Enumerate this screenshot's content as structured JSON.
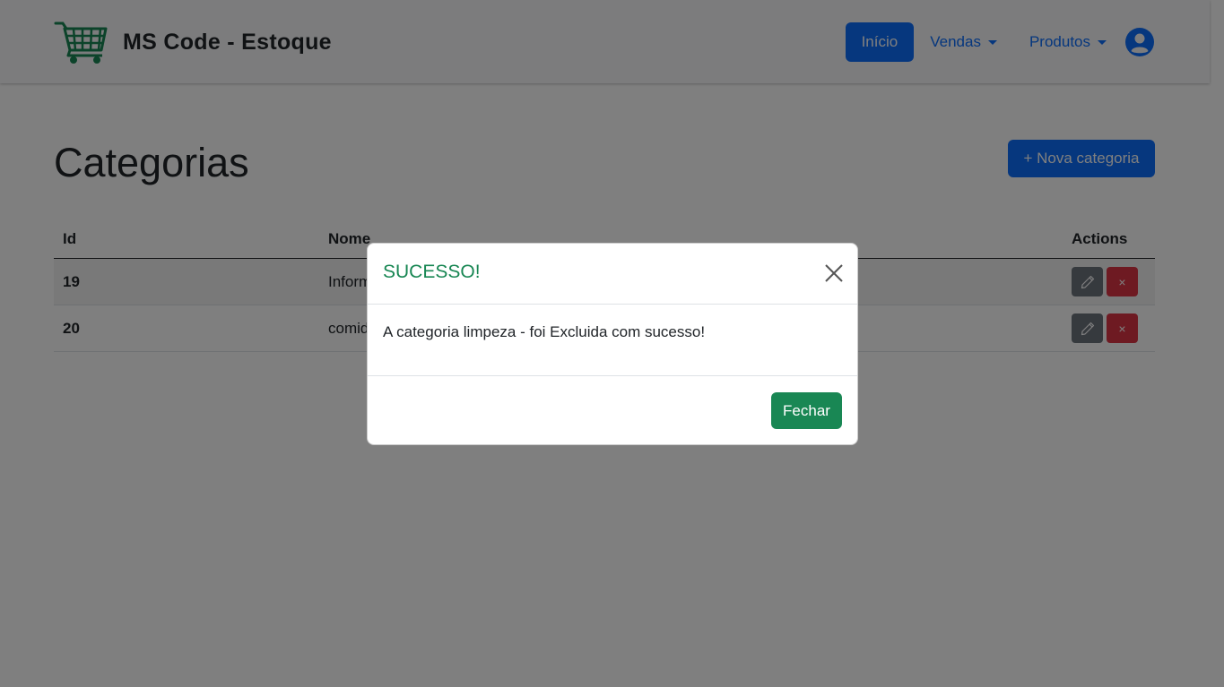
{
  "brand": {
    "title": "MS Code - Estoque",
    "logo_icon": "shopping-cart-icon",
    "logo_color": "#198754"
  },
  "nav": {
    "items": [
      {
        "label": "Início",
        "active": true
      },
      {
        "label": "Vendas",
        "dropdown": true
      },
      {
        "label": "Produtos",
        "dropdown": true
      }
    ],
    "user_icon": "user-circle-icon"
  },
  "page": {
    "title": "Categorias",
    "new_button": "+ Nova categoria"
  },
  "table": {
    "headers": {
      "id": "Id",
      "nome": "Nome",
      "actions": "Actions"
    },
    "rows": [
      {
        "id": "19",
        "nome": "Informática"
      },
      {
        "id": "20",
        "nome": "comida"
      }
    ],
    "edit_icon": "pencil-icon",
    "delete_icon": "x-icon",
    "delete_symbol": "×"
  },
  "modal": {
    "title": "SUCESSO!",
    "message": "A categoria limpeza - foi Excluida com sucesso!",
    "close_button": "Fechar",
    "close_icon": "close-icon"
  },
  "colors": {
    "primary": "#0d6efd",
    "success": "#198754",
    "danger": "#dc3545",
    "secondary": "#6c757d"
  }
}
